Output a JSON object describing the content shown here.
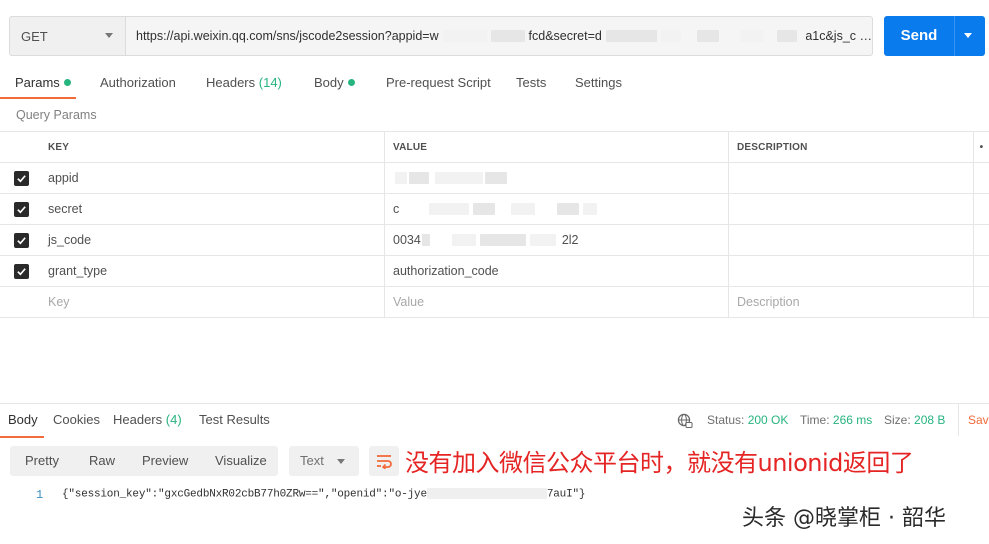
{
  "request": {
    "method": "GET",
    "url_part1": "https://api.weixin.qq.com/sns/jscode2session?appid=w",
    "url_part2": "fcd&secret=d",
    "url_part3": "a1c&js_c …",
    "send_label": "Send"
  },
  "request_tabs": {
    "params": "Params",
    "authorization": "Authorization",
    "headers": "Headers",
    "headers_count": "(14)",
    "body": "Body",
    "prerequest": "Pre-request Script",
    "tests": "Tests",
    "settings": "Settings"
  },
  "query_params": {
    "title": "Query Params",
    "columns": {
      "key": "KEY",
      "value": "VALUE",
      "description": "DESCRIPTION",
      "more": "•"
    },
    "rows": [
      {
        "key": "appid",
        "value": "",
        "checked": true
      },
      {
        "key": "secret",
        "value": "c",
        "checked": true
      },
      {
        "key": "js_code",
        "value": "0034",
        "value_tail": "2l2",
        "checked": true
      },
      {
        "key": "grant_type",
        "value": "authorization_code",
        "checked": true
      }
    ],
    "placeholders": {
      "key": "Key",
      "value": "Value",
      "description": "Description"
    }
  },
  "response_tabs": {
    "body": "Body",
    "cookies": "Cookies",
    "headers": "Headers",
    "headers_count": "(4)",
    "test_results": "Test Results"
  },
  "response_status": {
    "status_label": "Status:",
    "status_value": "200 OK",
    "time_label": "Time:",
    "time_value": "266 ms",
    "size_label": "Size:",
    "size_value": "208 B",
    "save_label": "Save"
  },
  "response_view": {
    "modes": [
      "Pretty",
      "Raw",
      "Preview",
      "Visualize"
    ],
    "format": "Text"
  },
  "annotation": "没有加入微信公众平台时，就没有unionid返回了",
  "response_body": {
    "line_number": "1",
    "text_start": "{\"session_key\":\"gxcGedbNxR02cbB77h0ZRw==\",\"openid\":\"o-jye",
    "text_end": "7auI\"}"
  },
  "watermark": "头条 @晓掌柜 · 韶华",
  "icons": {
    "method_caret": "chevron-down-icon",
    "send_caret": "chevron-down-icon",
    "checkbox": "check-icon",
    "globe": "globe-icon",
    "wrap": "wrap-lines-icon"
  },
  "colors": {
    "accent": "#f26b3a",
    "send": "#097bed",
    "success": "#26b47f",
    "annotation": "#e52424"
  }
}
